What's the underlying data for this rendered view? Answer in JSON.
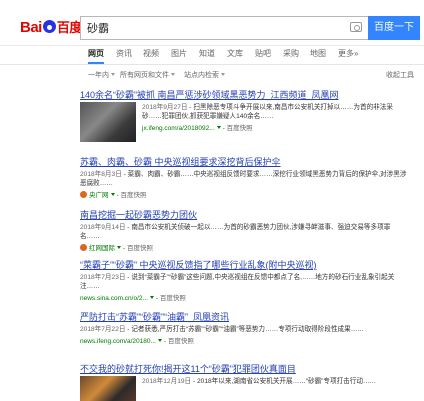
{
  "header": {
    "logo_text_1": "Bai",
    "logo_text_2": "百度",
    "search_value": "砂霸",
    "search_button": "百度一下"
  },
  "tabs": [
    "网页",
    "资讯",
    "视频",
    "图片",
    "知道",
    "文库",
    "贴吧",
    "采购",
    "地图",
    "更多»"
  ],
  "filters": {
    "range": "一年内",
    "file_type": "所有网页和文件",
    "site": "站点内检索",
    "collapse": "收起工具"
  },
  "results": [
    {
      "title": "140余名“砂霸”被抓 南昌严惩涉砂领域黑恶势力_江西频道_凤凰网",
      "date": "2018年9月27日",
      "snippet": " - 扫黑除恶专项斗争开展以来,南昌市公安机关打掉以……为首的非法采砂……犯罪团伙,抓获犯罪嫌疑人140余名……",
      "url": "jx.ifeng.com/a/2018092...",
      "snap": "百度快照"
    },
    {
      "title": "苏霸、肉霸、砂霸 中央巡视组要求深挖背后保护伞",
      "date": "2018年8月3日",
      "snippet": " - 菜霸、肉霸、砂霸……中央巡视组反馈时要求……深挖行业领域黑恶势力背后的保护伞,对涉黑涉恶腐败……",
      "url": "央广网",
      "snap": "百度快照"
    },
    {
      "title": "南昌挖掘一起砂霸恶势力团伙",
      "date": "2018年9月14日",
      "snippet": " - 南昌市公安机关侦破一起以……为首的砂霸恶势力团伙,涉嫌寻衅滋事、强迫交易等多项罪名……",
      "url": "红网国际",
      "snap": "百度快照"
    },
    {
      "title": "“菜霸子”“砂霸” 中央巡视反馈指了哪些行业乱象(附中央巡视)",
      "date": "2018年7月23日",
      "snippet": " - 说到“菜霸子”“砂霸”这些问题,中央巡视组在反馈中都点了名,……地方的砂石行业乱象引起关注……",
      "url": "news.sina.com.cn/o/2...",
      "snap": "百度快照"
    },
    {
      "title": "严防打击“苏霸”“砂霸”“油霸”_凤凰资讯",
      "date": "2018年7月22日",
      "snippet": " - 记者获悉,严厉打击“苏霸”“砂霸”“油霸”等恶势力……专项行动取得阶段性成果……",
      "url": "news.ifeng.com/a/20180...",
      "snap": "百度快照"
    },
    {
      "title": "不交我的砂就打死你!揭开这11个“砂霸”犯罪团伙真面目",
      "date": "2018年12月19日",
      "snippet": " - 2018年以来,湖南省公安机关开展……“砂霸”专项打击行动……",
      "url": "",
      "snap": ""
    }
  ]
}
